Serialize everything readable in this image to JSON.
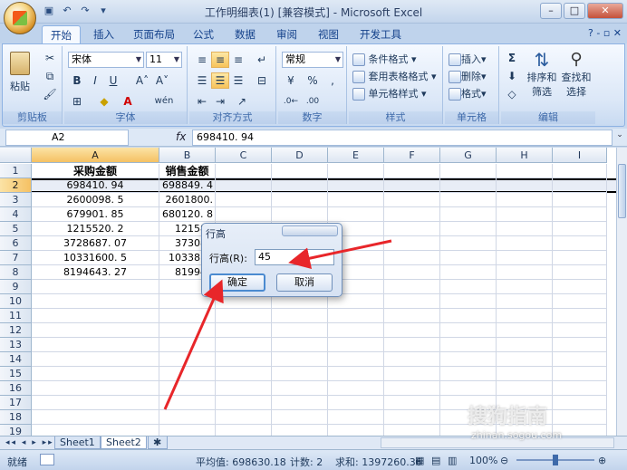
{
  "window": {
    "title": "工作明细表(1)  [兼容模式] - Microsoft Excel",
    "minimize": "–",
    "maximize": "□",
    "close": "✕"
  },
  "tabs": {
    "items": [
      "开始",
      "插入",
      "页面布局",
      "公式",
      "数据",
      "审阅",
      "视图",
      "开发工具"
    ],
    "active": "开始",
    "help": "? -  ▫  ✕"
  },
  "ribbon": {
    "clipboard": {
      "label": "剪贴板",
      "paste": "粘贴"
    },
    "font": {
      "label": "字体",
      "name": "宋体",
      "size": "11",
      "bold": "B",
      "italic": "I",
      "underline": "U",
      "grow": "A˄",
      "shrink": "A˅",
      "wen": "wén"
    },
    "alignment": {
      "label": "对齐方式"
    },
    "number": {
      "label": "数字",
      "format": "常规",
      "percent": "%",
      "comma": ","
    },
    "styles": {
      "label": "样式",
      "conditional": "条件格式",
      "table": "套用表格格式",
      "cell": "单元格样式"
    },
    "cells": {
      "label": "单元格",
      "insert": "插入",
      "delete": "删除",
      "format": "格式"
    },
    "editing": {
      "label": "编辑",
      "sum": "Σ",
      "sort": "排序和",
      "sort2": "筛选",
      "find": "查找和",
      "find2": "选择"
    }
  },
  "formula_bar": {
    "name_box": "A2",
    "fx": "fx",
    "formula": "698410. 94"
  },
  "sheet": {
    "columns": [
      "A",
      "B",
      "C",
      "D",
      "E",
      "F",
      "G",
      "H",
      "I"
    ],
    "rows": [
      "1",
      "2",
      "3",
      "4",
      "5",
      "6",
      "7",
      "8",
      "9",
      "10",
      "11",
      "12",
      "13",
      "14",
      "15",
      "16",
      "17",
      "18",
      "19"
    ],
    "header_a": "采购金额",
    "header_b": "销售金额",
    "col_a": [
      "698410. 94",
      "2600098. 5",
      "679901. 85",
      "1215520. 2",
      "3728687. 07",
      "10331600. 5",
      "8194643. 27"
    ],
    "col_b": [
      "698849. 4",
      "2601800.",
      "680120. 8",
      "121580",
      "373083",
      "1033816",
      "819945"
    ]
  },
  "dialog": {
    "title": "行高",
    "label": "行高(R):",
    "value": "45",
    "ok": "确定",
    "cancel": "取消"
  },
  "sheet_tabs": {
    "nav": "◂◂ ◂ ▸ ▸▸",
    "tabs": [
      "Sheet1",
      "Sheet2"
    ],
    "active": "Sheet2"
  },
  "status": {
    "ready": "就绪",
    "average": "平均值: 698630.18",
    "count": "计数: 2",
    "sum": "求和: 1397260.36",
    "zoom": "100%"
  },
  "watermark": {
    "brand": "搜狗指南",
    "url": "zhinan.sogou.com"
  }
}
